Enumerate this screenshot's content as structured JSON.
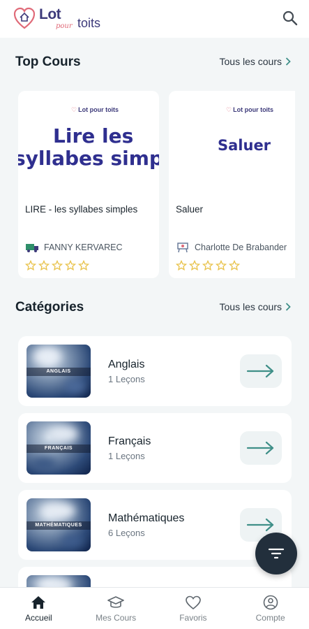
{
  "header": {
    "logo_lot": "Lot",
    "logo_pour": "pour",
    "logo_toits": "toits",
    "search_icon": "search-icon"
  },
  "top_courses": {
    "title": "Top Cours",
    "see_all": "Tous les cours",
    "items": [
      {
        "thumb_logo": "Lot pour toits",
        "thumb_line1": "Lire les",
        "thumb_line2": "syllabes simples",
        "title": "LIRE - les syllabes simples",
        "author": "FANNY KERVAREC",
        "rating": 0,
        "max_rating": 5
      },
      {
        "thumb_logo": "Lot pour toits",
        "thumb_line1": "Saluer",
        "title": "Saluer",
        "author": "Charlotte De Brabander",
        "rating": 0,
        "max_rating": 5
      }
    ]
  },
  "categories": {
    "title": "Catégories",
    "see_all": "Tous les cours",
    "items": [
      {
        "thumb_label": "ANGLAIS",
        "name": "Anglais",
        "count": "1 Leçons"
      },
      {
        "thumb_label": "FRANÇAIS",
        "name": "Français",
        "count": "1 Leçons"
      },
      {
        "thumb_label": "MATHÉMATIQUES",
        "name": "Mathématiques",
        "count": "6 Leçons"
      }
    ]
  },
  "fab": {
    "icon": "filter-icon"
  },
  "bottom_nav": {
    "items": [
      {
        "label": "Accueil",
        "icon": "home-icon",
        "active": true
      },
      {
        "label": "Mes Cours",
        "icon": "graduation-cap-icon",
        "active": false
      },
      {
        "label": "Favoris",
        "icon": "heart-icon",
        "active": false
      },
      {
        "label": "Compte",
        "icon": "account-icon",
        "active": false
      }
    ]
  },
  "colors": {
    "brand": "#3d3a7a",
    "accent": "#e06a78",
    "teal_arrow": "#3f8f88",
    "star": "#e8c24a",
    "fab": "#222f3c"
  }
}
